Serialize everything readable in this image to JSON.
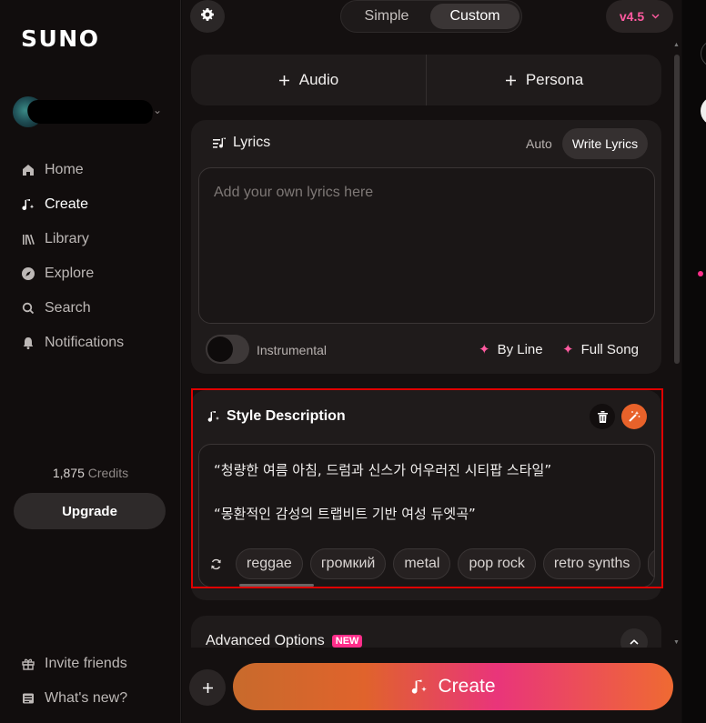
{
  "sidebar": {
    "logo": "SUNO",
    "nav": [
      {
        "label": "Home",
        "icon": "home-icon"
      },
      {
        "label": "Create",
        "icon": "create-note-icon",
        "active": true
      },
      {
        "label": "Library",
        "icon": "library-icon"
      },
      {
        "label": "Explore",
        "icon": "compass-icon"
      },
      {
        "label": "Search",
        "icon": "search-icon"
      },
      {
        "label": "Notifications",
        "icon": "bell-icon"
      }
    ],
    "credits_count": "1,875",
    "credits_label": "Credits",
    "upgrade_label": "Upgrade",
    "bottom": [
      {
        "label": "Invite friends",
        "icon": "gift-icon"
      },
      {
        "label": "What's new?",
        "icon": "news-icon"
      }
    ]
  },
  "header": {
    "mode_simple": "Simple",
    "mode_custom": "Custom",
    "selected_mode": "Custom",
    "version": "v4.5"
  },
  "add": {
    "audio_label": "Audio",
    "persona_label": "Persona"
  },
  "lyrics": {
    "title": "Lyrics",
    "auto_label": "Auto",
    "write_label": "Write Lyrics",
    "placeholder": "Add your own lyrics here",
    "instrumental_label": "Instrumental",
    "instrumental_on": false,
    "by_line_label": "By Line",
    "full_song_label": "Full Song"
  },
  "style": {
    "title": "Style Description",
    "text": "“청량한 여름 아침, 드럼과 신스가 어우러진 시티팝 스타일”\n\n“몽환적인 감성의 트랩비트 기반 여성 듀엣곡”",
    "tags": [
      "reggae",
      "громкий",
      "metal",
      "pop rock",
      "retro synths"
    ]
  },
  "advanced": {
    "title": "Advanced Options",
    "badge": "NEW"
  },
  "create_label": "Create",
  "colors": {
    "accent_pink": "#ff2e8a",
    "accent_orange": "#e8622a",
    "highlight_border": "#e00000"
  }
}
